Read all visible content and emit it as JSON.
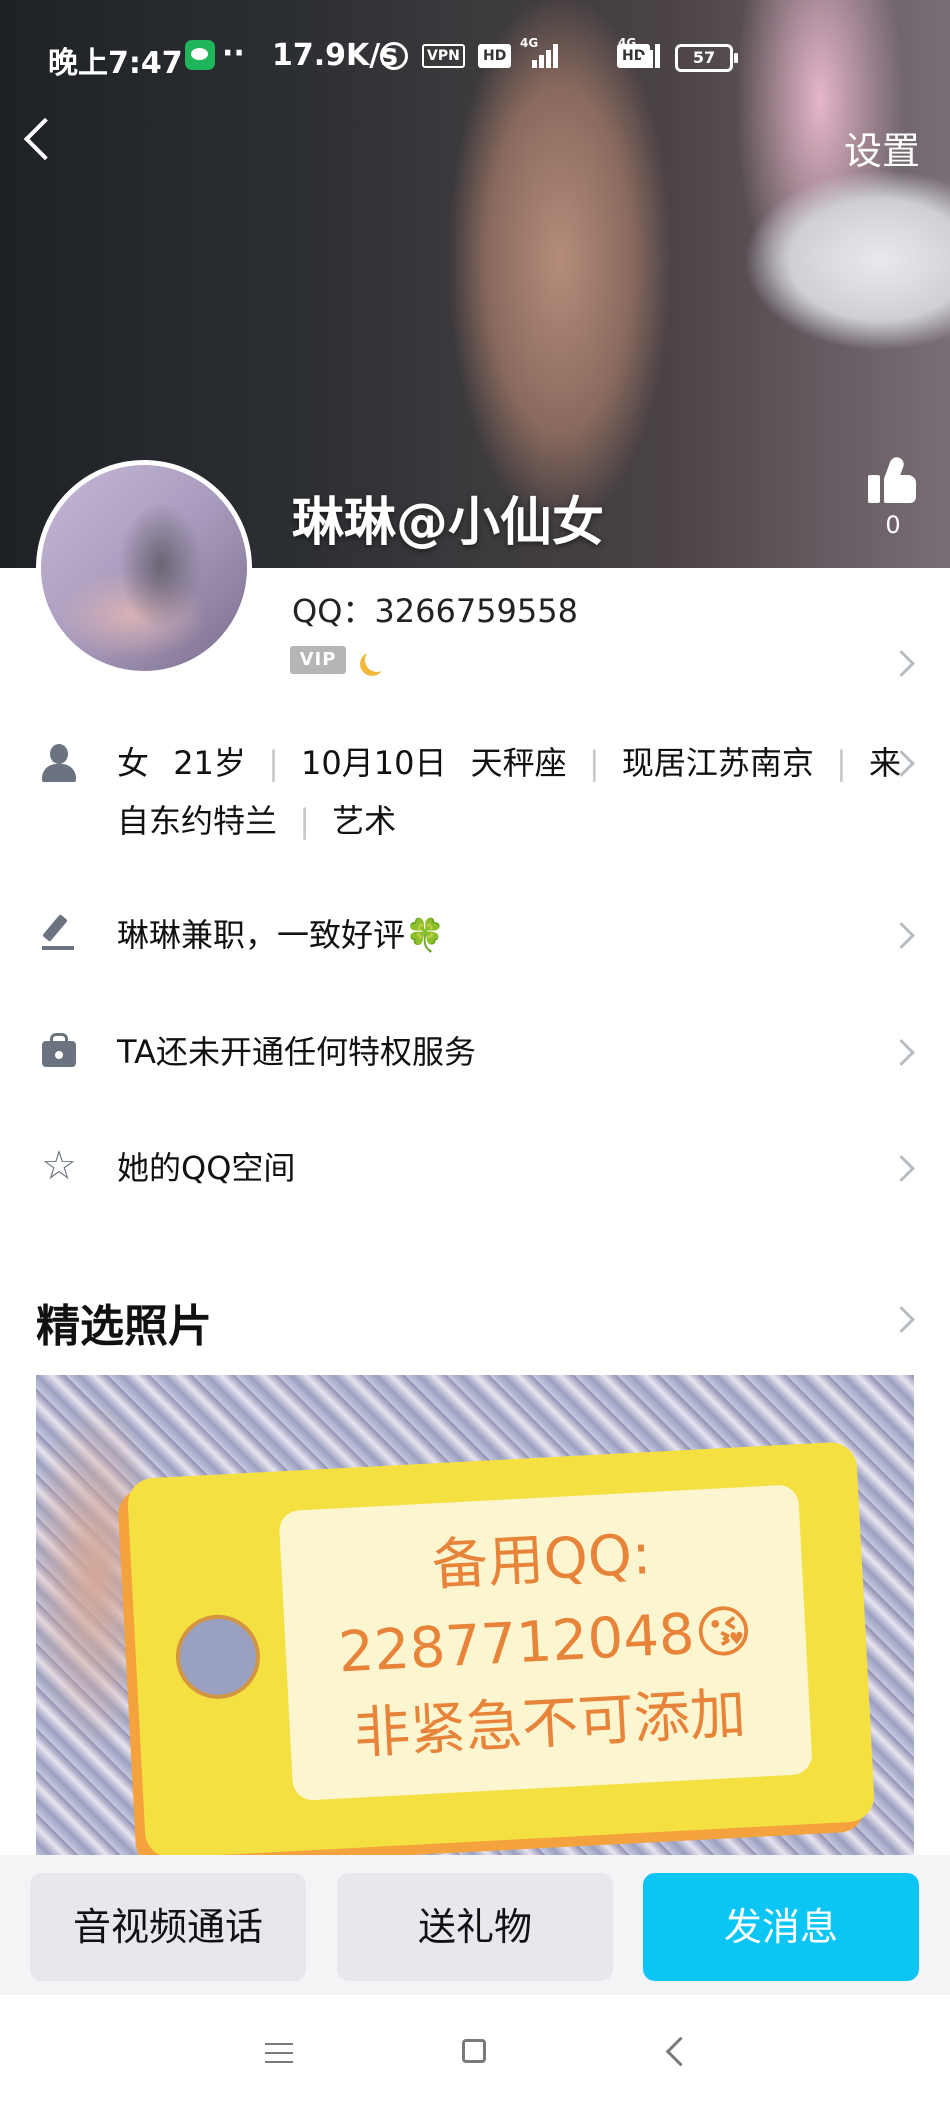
{
  "status_bar": {
    "time": "晚上7:47",
    "dots": "··",
    "speed": "17.9K/s",
    "vpn": "VPN",
    "hd": "HD",
    "network": "4G",
    "battery": "57"
  },
  "header": {
    "settings_label": "设置"
  },
  "profile": {
    "nickname": "琳琳@小仙女",
    "qq_number": "QQ：3266759558",
    "vip_label": "VIP",
    "like_count": "0"
  },
  "info_rows": {
    "basic": {
      "gender": "女",
      "age": "21岁",
      "birthday": "10月10日",
      "zodiac": "天秤座",
      "location": "现居江苏南京",
      "origin_line1": "来",
      "origin_line2": "自东约特兰",
      "occupation": "艺术",
      "separator": "|"
    },
    "signature": "琳琳兼职，一致好评🍀",
    "privilege": "TA还未开通任何特权服务",
    "qzone": "她的QQ空间"
  },
  "photos": {
    "section_title": "精选照片",
    "tag_line1": "备用QQ:",
    "tag_line2": "2287712048😘",
    "tag_line3": "非紧急不可添加"
  },
  "actions": {
    "call": "音视频通话",
    "gift": "送礼物",
    "message": "发消息"
  },
  "colors": {
    "accent": "#0BC6F5",
    "button_bg": "#E7E8EE",
    "icon_gray": "#6B7280"
  }
}
